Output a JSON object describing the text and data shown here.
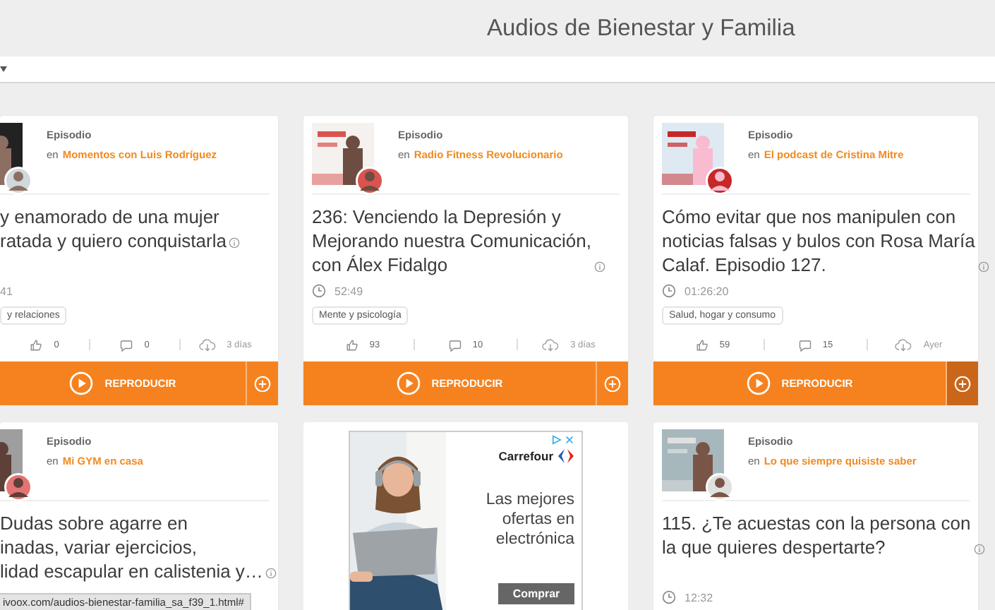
{
  "header": {
    "title": "Audios de Bienestar y Familia"
  },
  "cards": [
    {
      "kind": "episode",
      "label": "Episodio",
      "prefix": "en",
      "podcast": "Momentos con Luis Rodríguez",
      "title": "y enamorado de una mujer\nratada y quiero conquistarla",
      "duration": "41",
      "tag": "y relaciones",
      "likes": "0",
      "comments": "0",
      "age": "3 días",
      "play_label": "REPRODUCIR",
      "add_hovered": false
    },
    {
      "kind": "episode",
      "label": "Episodio",
      "prefix": "en",
      "podcast": "Radio Fitness Revolucionario",
      "title": "236: Venciendo la Depresión y\nMejorando nuestra Comunicación,\ncon Álex Fidalgo",
      "duration": "52:49",
      "tag": "Mente y psicología",
      "likes": "93",
      "comments": "10",
      "age": "3 días",
      "play_label": "REPRODUCIR",
      "add_hovered": false
    },
    {
      "kind": "episode",
      "label": "Episodio",
      "prefix": "en",
      "podcast": "El podcast de Cristina Mitre",
      "title": "Cómo evitar que nos manipulen con\nnoticias falsas y bulos con Rosa María\nCalaf. Episodio 127.",
      "duration": "01:26:20",
      "tag": "Salud, hogar y consumo",
      "likes": "59",
      "comments": "15",
      "age": "Ayer",
      "play_label": "REPRODUCIR",
      "add_hovered": true
    },
    {
      "kind": "episode",
      "label": "Episodio",
      "prefix": "en",
      "podcast": "Mi GYM en casa",
      "title": "Dudas sobre agarre en\ninadas, variar ejercicios,\nlidad escapular en calistenia y…"
    },
    {
      "kind": "ad",
      "brand": "Carrefour",
      "headline": "Las mejores\nofertas en\nelectrónica",
      "cta": "Comprar"
    },
    {
      "kind": "episode",
      "label": "Episodio",
      "prefix": "en",
      "podcast": "Lo que siempre quisiste saber",
      "title": "115. ¿Te acuestas con la persona con\nla que quieres despertarte?",
      "duration": "12:32"
    }
  ],
  "status_url": "ivoox.com/audios-bienestar-familia_sa_f39_1.html#"
}
